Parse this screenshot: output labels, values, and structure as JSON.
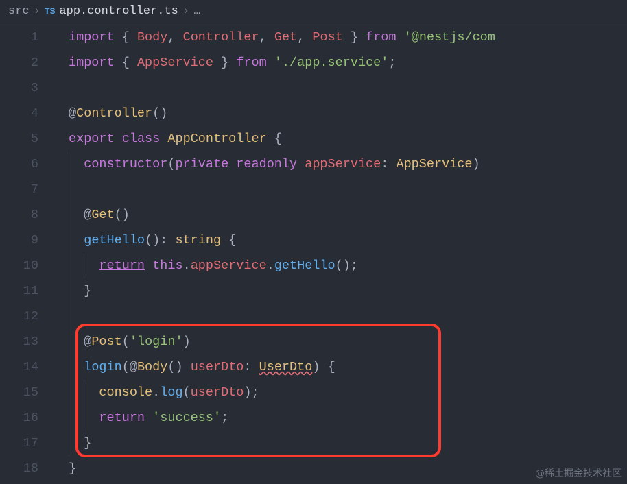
{
  "breadcrumbs": {
    "folder": "src",
    "ts_badge": "TS",
    "filename": "app.controller.ts",
    "trailing": "…"
  },
  "lines": [
    {
      "n": "1",
      "tokens": [
        {
          "t": "import",
          "c": "tk-kw"
        },
        {
          "t": " ",
          "c": ""
        },
        {
          "t": "{",
          "c": "tk-punc"
        },
        {
          "t": " ",
          "c": ""
        },
        {
          "t": "Body",
          "c": "tk-var"
        },
        {
          "t": ", ",
          "c": "tk-punc"
        },
        {
          "t": "Controller",
          "c": "tk-var"
        },
        {
          "t": ", ",
          "c": "tk-punc"
        },
        {
          "t": "Get",
          "c": "tk-var"
        },
        {
          "t": ", ",
          "c": "tk-punc"
        },
        {
          "t": "Post",
          "c": "tk-var"
        },
        {
          "t": " ",
          "c": ""
        },
        {
          "t": "}",
          "c": "tk-punc"
        },
        {
          "t": " ",
          "c": ""
        },
        {
          "t": "from",
          "c": "tk-kw"
        },
        {
          "t": " ",
          "c": ""
        },
        {
          "t": "'@nestjs/com",
          "c": "tk-str"
        }
      ],
      "indent": 0
    },
    {
      "n": "2",
      "tokens": [
        {
          "t": "import",
          "c": "tk-kw"
        },
        {
          "t": " ",
          "c": ""
        },
        {
          "t": "{",
          "c": "tk-punc"
        },
        {
          "t": " ",
          "c": ""
        },
        {
          "t": "AppService",
          "c": "tk-var"
        },
        {
          "t": " ",
          "c": ""
        },
        {
          "t": "}",
          "c": "tk-punc"
        },
        {
          "t": " ",
          "c": ""
        },
        {
          "t": "from",
          "c": "tk-kw"
        },
        {
          "t": " ",
          "c": ""
        },
        {
          "t": "'./app.service'",
          "c": "tk-str"
        },
        {
          "t": ";",
          "c": "tk-punc"
        }
      ],
      "indent": 0
    },
    {
      "n": "3",
      "tokens": [],
      "indent": 0
    },
    {
      "n": "4",
      "tokens": [
        {
          "t": "@",
          "c": "tk-punc"
        },
        {
          "t": "Controller",
          "c": "tk-dec"
        },
        {
          "t": "()",
          "c": "tk-punc"
        }
      ],
      "indent": 0
    },
    {
      "n": "5",
      "tokens": [
        {
          "t": "export",
          "c": "tk-kw"
        },
        {
          "t": " ",
          "c": ""
        },
        {
          "t": "class",
          "c": "tk-kw"
        },
        {
          "t": " ",
          "c": ""
        },
        {
          "t": "AppController",
          "c": "tk-type"
        },
        {
          "t": " ",
          "c": ""
        },
        {
          "t": "{",
          "c": "tk-punc"
        }
      ],
      "indent": 0
    },
    {
      "n": "6",
      "tokens": [
        {
          "t": "  ",
          "c": ""
        },
        {
          "t": "constructor",
          "c": "tk-kw"
        },
        {
          "t": "(",
          "c": "tk-punc"
        },
        {
          "t": "private",
          "c": "tk-kw"
        },
        {
          "t": " ",
          "c": ""
        },
        {
          "t": "readonly",
          "c": "tk-kw"
        },
        {
          "t": " ",
          "c": ""
        },
        {
          "t": "appService",
          "c": "tk-var"
        },
        {
          "t": ": ",
          "c": "tk-punc"
        },
        {
          "t": "AppService",
          "c": "tk-type"
        },
        {
          "t": ")",
          "c": "tk-punc"
        },
        {
          "t": " ",
          "c": ""
        }
      ],
      "indent": 1
    },
    {
      "n": "7",
      "tokens": [],
      "indent": 1
    },
    {
      "n": "8",
      "tokens": [
        {
          "t": "  ",
          "c": ""
        },
        {
          "t": "@",
          "c": "tk-punc"
        },
        {
          "t": "Get",
          "c": "tk-dec"
        },
        {
          "t": "()",
          "c": "tk-punc"
        }
      ],
      "indent": 1
    },
    {
      "n": "9",
      "tokens": [
        {
          "t": "  ",
          "c": ""
        },
        {
          "t": "getHello",
          "c": "tk-fn"
        },
        {
          "t": "(): ",
          "c": "tk-punc"
        },
        {
          "t": "string",
          "c": "tk-type"
        },
        {
          "t": " ",
          "c": ""
        },
        {
          "t": "{",
          "c": "tk-punc"
        }
      ],
      "indent": 1
    },
    {
      "n": "10",
      "tokens": [
        {
          "t": "    ",
          "c": ""
        },
        {
          "t": "return",
          "c": "tk-ret"
        },
        {
          "t": " ",
          "c": ""
        },
        {
          "t": "this",
          "c": "tk-kw"
        },
        {
          "t": ".",
          "c": "tk-punc"
        },
        {
          "t": "appService",
          "c": "tk-var"
        },
        {
          "t": ".",
          "c": "tk-punc"
        },
        {
          "t": "getHello",
          "c": "tk-fn"
        },
        {
          "t": "();",
          "c": "tk-punc"
        }
      ],
      "indent": 2
    },
    {
      "n": "11",
      "tokens": [
        {
          "t": "  ",
          "c": ""
        },
        {
          "t": "}",
          "c": "tk-punc"
        }
      ],
      "indent": 1
    },
    {
      "n": "12",
      "tokens": [],
      "indent": 1
    },
    {
      "n": "13",
      "tokens": [
        {
          "t": "  ",
          "c": ""
        },
        {
          "t": "@",
          "c": "tk-punc"
        },
        {
          "t": "Post",
          "c": "tk-dec"
        },
        {
          "t": "(",
          "c": "tk-punc"
        },
        {
          "t": "'login'",
          "c": "tk-str"
        },
        {
          "t": ")",
          "c": "tk-punc"
        }
      ],
      "indent": 1
    },
    {
      "n": "14",
      "tokens": [
        {
          "t": "  ",
          "c": ""
        },
        {
          "t": "login",
          "c": "tk-fn"
        },
        {
          "t": "(",
          "c": "tk-punc"
        },
        {
          "t": "@",
          "c": "tk-punc"
        },
        {
          "t": "Body",
          "c": "tk-dec"
        },
        {
          "t": "() ",
          "c": "tk-punc"
        },
        {
          "t": "userDto",
          "c": "tk-var"
        },
        {
          "t": ": ",
          "c": "tk-punc"
        },
        {
          "t": "UserDto",
          "c": "tk-err"
        },
        {
          "t": ") ",
          "c": "tk-punc"
        },
        {
          "t": "{",
          "c": "tk-punc"
        }
      ],
      "indent": 1
    },
    {
      "n": "15",
      "tokens": [
        {
          "t": "    ",
          "c": ""
        },
        {
          "t": "console",
          "c": "tk-type"
        },
        {
          "t": ".",
          "c": "tk-punc"
        },
        {
          "t": "log",
          "c": "tk-fn"
        },
        {
          "t": "(",
          "c": "tk-punc"
        },
        {
          "t": "userDto",
          "c": "tk-var"
        },
        {
          "t": ");",
          "c": "tk-punc"
        }
      ],
      "indent": 2
    },
    {
      "n": "16",
      "tokens": [
        {
          "t": "    ",
          "c": ""
        },
        {
          "t": "return",
          "c": "tk-kw"
        },
        {
          "t": " ",
          "c": ""
        },
        {
          "t": "'success'",
          "c": "tk-str"
        },
        {
          "t": ";",
          "c": "tk-punc"
        }
      ],
      "indent": 2
    },
    {
      "n": "17",
      "tokens": [
        {
          "t": "  ",
          "c": ""
        },
        {
          "t": "}",
          "c": "tk-punc"
        }
      ],
      "indent": 1
    },
    {
      "n": "18",
      "tokens": [
        {
          "t": "}",
          "c": "tk-punc"
        }
      ],
      "indent": 0
    }
  ],
  "watermark": "@稀土掘金技术社区"
}
